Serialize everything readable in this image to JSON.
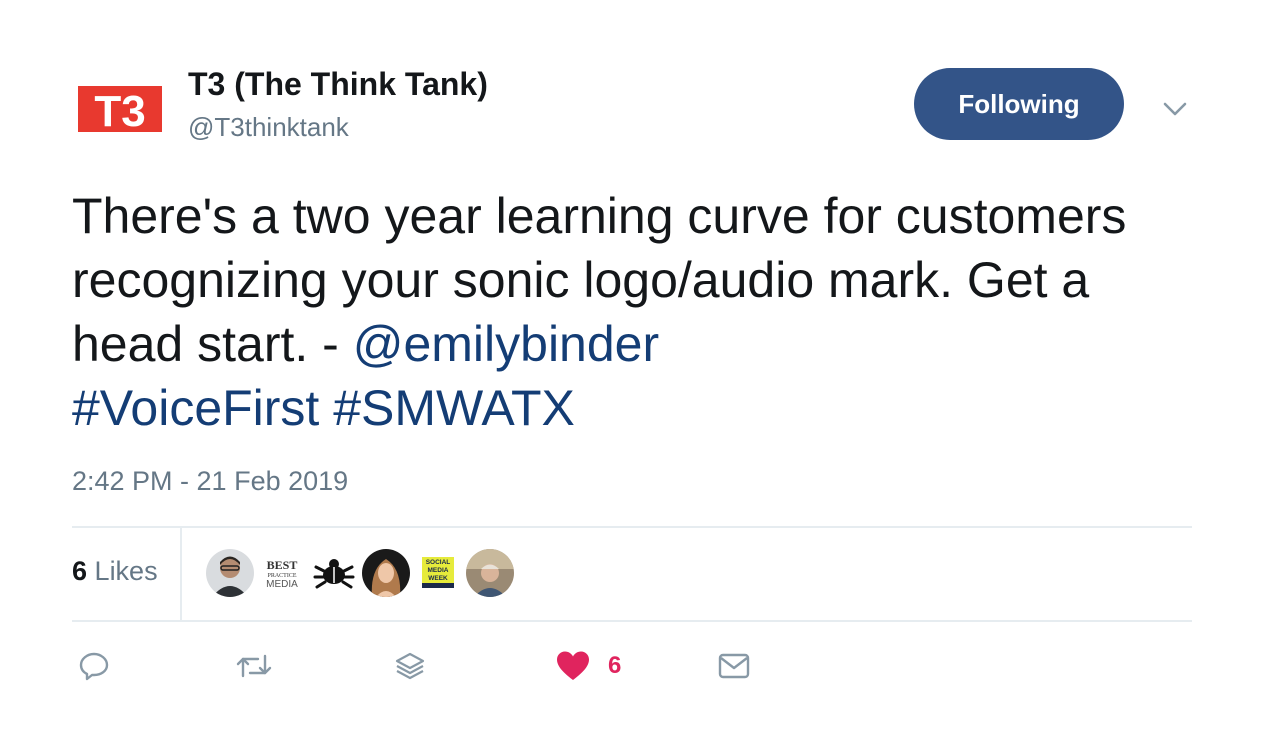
{
  "account": {
    "logo_text": "T3",
    "display_name": "T3 (The Think Tank)",
    "handle": "@T3thinktank",
    "follow_button_label": "Following"
  },
  "tweet": {
    "text_plain": "There's a two year learning curve for customers recognizing your sonic logo/audio mark. Get a head start. - ",
    "mention": "@emilybinder",
    "hashtags": [
      "#VoiceFirst",
      "#SMWATX"
    ],
    "timestamp": "2:42 PM - 21 Feb 2019"
  },
  "likes": {
    "count": "6",
    "label": "Likes",
    "avatars": [
      {
        "name": "person-with-glasses"
      },
      {
        "name": "best-practice-media",
        "text_lines": [
          "BEST",
          "PRACTICE",
          "MEDIA"
        ]
      },
      {
        "name": "bug-logo"
      },
      {
        "name": "woman-portrait"
      },
      {
        "name": "social-media-week",
        "text_lines": [
          "SOCIAL",
          "MEDIA",
          "WEEK"
        ]
      },
      {
        "name": "older-man-portrait"
      }
    ]
  },
  "actions": {
    "reply_icon": "reply-icon",
    "retweet_icon": "retweet-icon",
    "stack_icon": "stack-icon",
    "like_icon": "heart-icon",
    "like_count": "6",
    "dm_icon": "envelope-icon"
  },
  "colors": {
    "follow_button": "#335488",
    "link": "#143d75",
    "secondary_text": "#657786",
    "like": "#e0245e",
    "logo_red": "#e8392f"
  }
}
